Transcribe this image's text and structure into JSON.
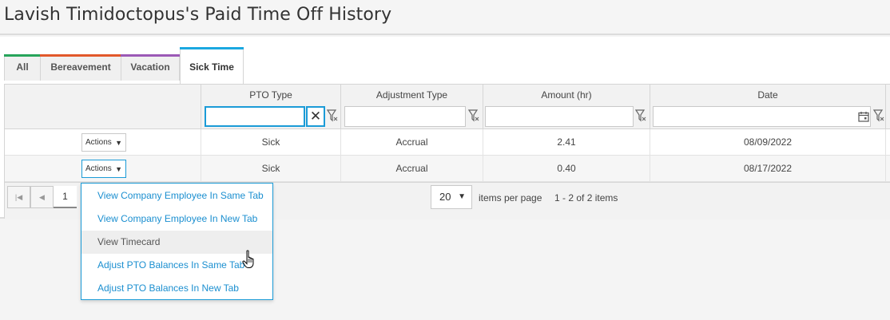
{
  "page_title": "Lavish Timidoctopus's Paid Time Off History",
  "tabs": [
    {
      "label": "All",
      "color": "#27a45a"
    },
    {
      "label": "Bereavement",
      "color": "#e2582b"
    },
    {
      "label": "Vacation",
      "color": "#9b59b6"
    },
    {
      "label": "Sick Time",
      "color": "#1ba8e0"
    }
  ],
  "active_tab": "Sick Time",
  "columns": [
    "PTO Type",
    "Adjustment Type",
    "Amount (hr)",
    "Date"
  ],
  "filters": {
    "pto_type": "",
    "adjustment_type": "",
    "amount": "",
    "date": ""
  },
  "rows": [
    {
      "actions": "Actions",
      "pto_type": "Sick",
      "adjustment_type": "Accrual",
      "amount": "2.41",
      "date": "08/09/2022"
    },
    {
      "actions": "Actions",
      "pto_type": "Sick",
      "adjustment_type": "Accrual",
      "amount": "0.40",
      "date": "08/17/2022"
    }
  ],
  "pager": {
    "current_page": "1",
    "page_size": "20",
    "items_per_page_label": "items per page",
    "summary": "1 - 2 of 2 items"
  },
  "actions_menu": [
    "View Company Employee In Same Tab",
    "View Company Employee In New Tab",
    "View Timecard",
    "Adjust PTO Balances In Same Tab",
    "Adjust PTO Balances In New Tab"
  ],
  "hovered_menu_item": "View Timecard",
  "accent_color": "#1b9bd7"
}
